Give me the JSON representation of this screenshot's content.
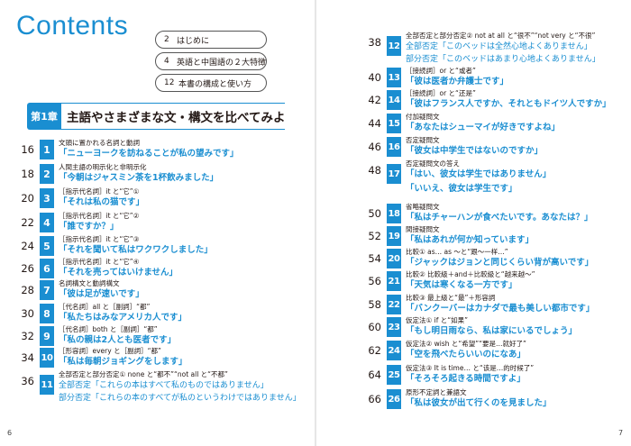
{
  "title": "Contents",
  "front_matter": [
    {
      "page": "2",
      "label": "はじめに"
    },
    {
      "page": "4",
      "label": "英語と中国語の２大特徴"
    },
    {
      "page": "12",
      "label": "本書の構成と使い方"
    }
  ],
  "chapter": {
    "badge": "第1章",
    "title": "主語やさまざまな文・構文を比べてみよう"
  },
  "left_entries": [
    {
      "page": "16",
      "num": "1",
      "category": "文頭に置かれる名詞と動詞",
      "example": "「ニューヨークを訪ねることが私の望みです」"
    },
    {
      "page": "18",
      "num": "2",
      "category": "人間主語の明示化と非明示化",
      "example": "「今朝はジャスミン茶を1杯飲みました」"
    },
    {
      "page": "20",
      "num": "3",
      "category": "［指示代名詞］it と“它”①",
      "example": "「それは私の猫です」"
    },
    {
      "page": "22",
      "num": "4",
      "category": "［指示代名詞］it と“它”②",
      "example": "「誰ですか？」"
    },
    {
      "page": "24",
      "num": "5",
      "category": "［指示代名詞］it と“它”③",
      "example": "「それを聞いて私はワクワクしました」"
    },
    {
      "page": "26",
      "num": "6",
      "category": "［指示代名詞］it と“它”④",
      "example": "「それを売ってはいけません」"
    },
    {
      "page": "28",
      "num": "7",
      "category": "名詞構文と動詞構文",
      "example": "「彼は足が速いです」"
    },
    {
      "page": "30",
      "num": "8",
      "category": "［代名詞］all と［副詞］“都”",
      "example": "「私たちはみなアメリカ人です」"
    },
    {
      "page": "32",
      "num": "9",
      "category": "［代名詞］both と［副詞］“都”",
      "example": "「私の親は2人とも医者です」"
    },
    {
      "page": "34",
      "num": "10",
      "category": "［形容詞］every と［副詞］“都”",
      "example": "「私は毎朝ジョギングをします」"
    },
    {
      "page": "36",
      "num": "11",
      "category": "全部否定と部分否定① none と“都不”“not all と“不都”",
      "example": "全部否定「これらの本はすべて私のものではありません」",
      "example2": "部分否定「これらの本のすべてが私のというわけではありません」"
    }
  ],
  "right_entries": [
    {
      "page": "38",
      "num": "12",
      "category": "全部否定と部分否定② not at all と“很不”“not very と“不很”",
      "example": "全部否定「このベッドは全然心地よくありません」",
      "example2": "部分否定「このベッドはあまり心地よくありません」"
    },
    {
      "page": "40",
      "num": "13",
      "category": "［接続詞］or と“或者”",
      "example": "「彼は医者か弁護士です」"
    },
    {
      "page": "42",
      "num": "14",
      "category": "［接続詞］or と“还是”",
      "example": "「彼はフランス人ですか、それともドイツ人ですか」"
    },
    {
      "page": "44",
      "num": "15",
      "category": "付加疑問文",
      "example": "「あなたはシューマイが好きですよね」"
    },
    {
      "page": "46",
      "num": "16",
      "category": "否定疑問文",
      "example": "「彼女は中学生ではないのですか」"
    },
    {
      "page": "48",
      "num": "17",
      "category": "否定疑問文の答え",
      "example": "「はい、彼女は学生ではありません」",
      "example2": "「いいえ、彼女は学生です」"
    },
    {
      "page": "50",
      "num": "18",
      "category": "省略疑問文",
      "example": "「私はチャーハンが食べたいです。あなたは？」"
    },
    {
      "page": "52",
      "num": "19",
      "category": "間接疑問文",
      "example": "「私はあれが何か知っています」"
    },
    {
      "page": "54",
      "num": "20",
      "category": "比較① as… as ～と“跟～一样…”",
      "example": "「ジャックはジョンと同じくらい背が高いです」"
    },
    {
      "page": "56",
      "num": "21",
      "category": "比較② 比較級＋and＋比較級と“越来越～”",
      "example": "「天気は寒くなる一方です」"
    },
    {
      "page": "58",
      "num": "22",
      "category": "比較③ 最上級と“最”＋形容詞",
      "example": "「バンクーバーはカナダで最も美しい都市です」"
    },
    {
      "page": "60",
      "num": "23",
      "category": "仮定法① if と“如果”",
      "example": "「もし明日雨なら、私は家にいるでしょう」"
    },
    {
      "page": "62",
      "num": "24",
      "category": "仮定法② wish と“希望”“要是…就好了”",
      "example": "「空を飛べたらいいのになあ」"
    },
    {
      "page": "64",
      "num": "25",
      "category": "仮定法③ It is time… と“该是…的时候了”",
      "example": "「そろそろ起きる時間ですよ」"
    },
    {
      "page": "66",
      "num": "26",
      "category": "原形不定詞と兼語文",
      "example": "「私は彼女が出て行くのを見ました」"
    }
  ],
  "page_numbers": {
    "left": "6",
    "right": "7"
  },
  "colors": {
    "accent": "#1a8ed1",
    "text": "#231815"
  }
}
